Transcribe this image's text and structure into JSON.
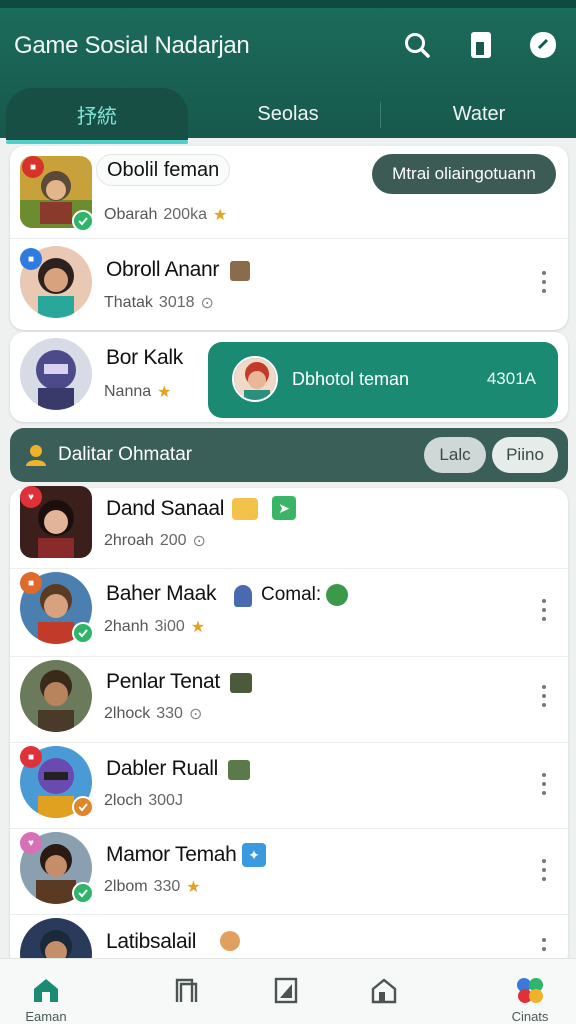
{
  "header": {
    "title": "Game Sosial Nadarjan"
  },
  "tabs": [
    {
      "label": "抒統",
      "active": true
    },
    {
      "label": "Seolas",
      "active": false
    },
    {
      "label": "Water",
      "active": false
    }
  ],
  "top_card": {
    "rows": [
      {
        "name": "Obolil feman",
        "stat_label": "Obarah",
        "stat_value": "200ka"
      },
      {
        "name": "Obroll Ananr",
        "stat_label": "Thatak",
        "stat_value": "3018"
      },
      {
        "name": "Bor Kalk",
        "stat_label": "Nanna"
      }
    ],
    "action_button": "Mtrai oliaingotuann",
    "highlight": {
      "label": "Dbhotol teman",
      "value": "4301A"
    }
  },
  "section": {
    "title": "Dalitar Ohmatar",
    "btn1": "Lalc",
    "btn2": "Piino"
  },
  "friends": [
    {
      "name": "Dand Sanaal",
      "stat_label": "2hroah",
      "stat_value": "200"
    },
    {
      "name": "Baher Maak",
      "extra": "Comal:",
      "stat_label": "2hanh",
      "stat_value": "3i00"
    },
    {
      "name": "Penlar Tenat",
      "stat_label": "2lhock",
      "stat_value": "330"
    },
    {
      "name": "Dabler Ruall",
      "stat_label": "2loch",
      "stat_value": "300J"
    },
    {
      "name": "Mamor Temah",
      "stat_label": "2lbom",
      "stat_value": "330"
    },
    {
      "name": "Latibsalail"
    }
  ],
  "bottom_nav": [
    {
      "label": "Eaman",
      "icon": "home-icon",
      "active": true
    },
    {
      "label": "",
      "icon": "doorway-icon"
    },
    {
      "label": "",
      "icon": "note-icon"
    },
    {
      "label": "",
      "icon": "house-icon"
    },
    {
      "label": "Cinats",
      "icon": "games-icon"
    }
  ],
  "colors": {
    "primary": "#1c6b5b",
    "accent": "#4fd0cb",
    "teal_button": "#1a8a72",
    "section_bar": "#3a5f58"
  }
}
